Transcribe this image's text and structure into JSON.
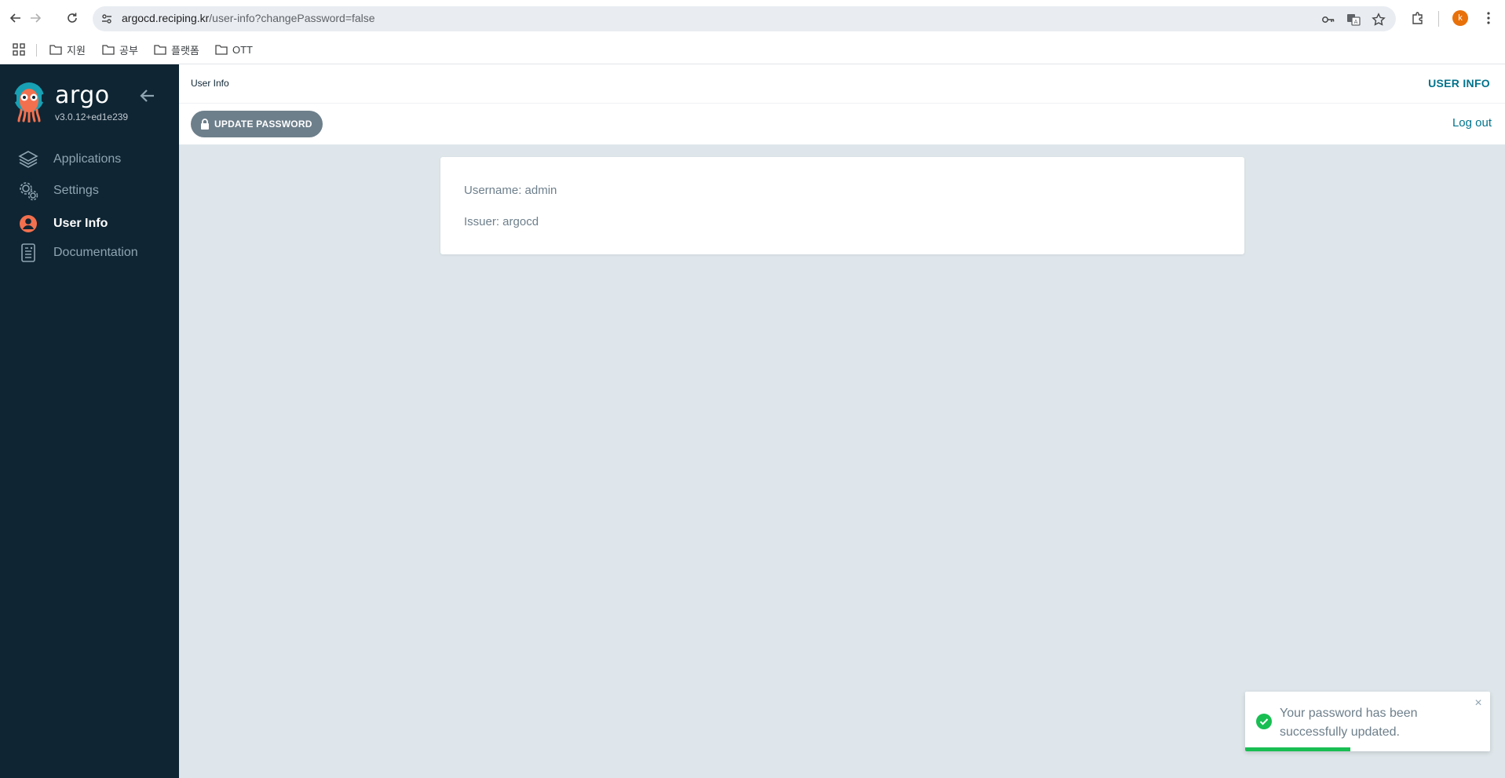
{
  "browser": {
    "url_host": "argocd.reciping.kr",
    "url_path": "/user-info?changePassword=false",
    "profile_initial": "k",
    "bookmarks": [
      {
        "label": "지원"
      },
      {
        "label": "공부"
      },
      {
        "label": "플랫폼"
      },
      {
        "label": "OTT"
      }
    ]
  },
  "sidebar": {
    "brand": "argo",
    "version": "v3.0.12+ed1e239",
    "items": [
      {
        "label": "Applications",
        "icon": "layers-icon",
        "active": false
      },
      {
        "label": "Settings",
        "icon": "gears-icon",
        "active": false
      },
      {
        "label": "User Info",
        "icon": "user-circle-icon",
        "active": true
      },
      {
        "label": "Documentation",
        "icon": "book-icon",
        "active": false
      }
    ]
  },
  "header": {
    "breadcrumb": "User Info",
    "title": "USER INFO"
  },
  "actions": {
    "update_password": "UPDATE PASSWORD",
    "logout": "Log out"
  },
  "user": {
    "username_line": "Username: admin",
    "issuer_line": "Issuer: argocd"
  },
  "toast": {
    "message": "Your password has been successfully updated.",
    "progress": 0.43,
    "color": "#18be52"
  },
  "colors": {
    "sidebar_bg": "#0f2533",
    "accent": "#00738c",
    "brand_orange": "#f3704e"
  }
}
